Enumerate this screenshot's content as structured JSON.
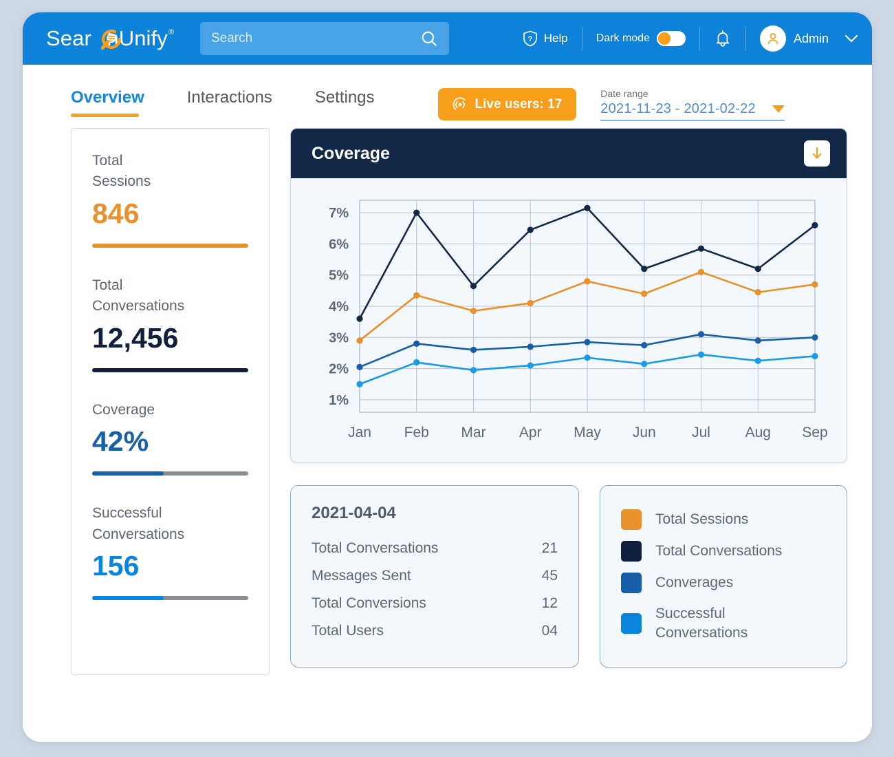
{
  "header": {
    "brand_main": "Sear",
    "brand_rest": "hUnify",
    "brand_reg": "®",
    "search_placeholder": "Search",
    "search_value": "",
    "help_label": "Help",
    "dark_mode_label": "Dark mode",
    "dark_mode_on": false,
    "account_name": "Admin"
  },
  "tabs": [
    {
      "label": "Overview",
      "active": true
    },
    {
      "label": "Interactions",
      "active": false
    },
    {
      "label": "Settings",
      "active": false
    }
  ],
  "toolbar": {
    "live_users_label": "Live users: 17",
    "date_range_label": "Date range",
    "date_range_value": "2021-11-23  -  2021-02-22"
  },
  "metrics": [
    {
      "label": "Total\nSessions",
      "value": "846",
      "color": "#e8912d",
      "progress": 100
    },
    {
      "label": "Total\nConversations",
      "value": "12,456",
      "color": "#0f1f3c",
      "progress": 100
    },
    {
      "label": "Coverage",
      "value": "42%",
      "color": "#175fa8",
      "progress": 46
    },
    {
      "label": "Successful\nConversations",
      "value": "156",
      "color": "#0a85dd",
      "progress": 46
    }
  ],
  "chart_card": {
    "title": "Coverage",
    "download_icon": "download-arrow-icon"
  },
  "chart_data": {
    "type": "line",
    "title": "Coverage",
    "xlabel": "",
    "ylabel": "",
    "categories": [
      "Jan",
      "Feb",
      "Mar",
      "Apr",
      "May",
      "Jun",
      "Jul",
      "Aug",
      "Sep"
    ],
    "ylim": [
      0.6,
      7.4
    ],
    "yticks": [
      1,
      2,
      3,
      4,
      5,
      6,
      7
    ],
    "ytick_labels": [
      "1%",
      "2%",
      "3%",
      "4%",
      "5%",
      "6%",
      "7%"
    ],
    "grid": true,
    "legend_position": "external-bottom-right",
    "series": [
      {
        "name": "Total Conversations",
        "color": "#132848",
        "values": [
          3.6,
          7.0,
          4.65,
          6.45,
          7.15,
          5.2,
          5.85,
          5.2,
          6.6
        ]
      },
      {
        "name": "Total Sessions",
        "color": "#e8912d",
        "values": [
          2.9,
          4.35,
          3.85,
          4.1,
          4.8,
          4.4,
          5.1,
          4.45,
          4.7
        ]
      },
      {
        "name": "Converages",
        "color": "#175fa8",
        "values": [
          2.05,
          2.8,
          2.6,
          2.7,
          2.85,
          2.75,
          3.1,
          2.9,
          3.0
        ]
      },
      {
        "name": "Successful Conversations",
        "color": "#1b9ae8",
        "values": [
          1.5,
          2.2,
          1.95,
          2.1,
          2.35,
          2.15,
          2.45,
          2.25,
          2.4
        ]
      }
    ]
  },
  "detail_panel": {
    "date": "2021-04-04",
    "rows": [
      {
        "label": "Total Conversations",
        "value": "21"
      },
      {
        "label": "Messages Sent",
        "value": "45"
      },
      {
        "label": "Total Conversions",
        "value": "12"
      },
      {
        "label": "Total Users",
        "value": "04"
      }
    ]
  },
  "legend": [
    {
      "label": "Total Sessions",
      "color": "#e8912d"
    },
    {
      "label": "Total Conversations",
      "color": "#0f1f3c"
    },
    {
      "label": "Converages",
      "color": "#175fa8"
    },
    {
      "label": "Successful Conversations",
      "color": "#0a85dd"
    }
  ]
}
